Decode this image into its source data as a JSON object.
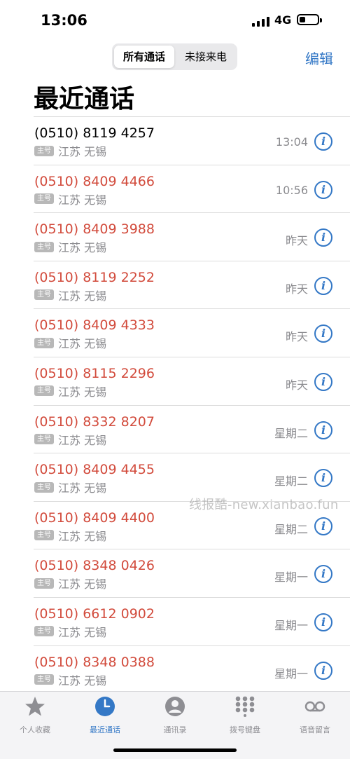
{
  "status": {
    "time": "13:06",
    "network": "4G"
  },
  "segmented": {
    "all_calls": "所有通话",
    "missed_calls": "未接来电"
  },
  "header": {
    "edit": "编辑",
    "title": "最近通话"
  },
  "calls": [
    {
      "number": "(0510) 8119 4257",
      "badge": "主号",
      "location": "江苏 无锡",
      "time": "13:04",
      "missed": false
    },
    {
      "number": "(0510) 8409 4466",
      "badge": "主号",
      "location": "江苏 无锡",
      "time": "10:56",
      "missed": true
    },
    {
      "number": "(0510) 8409 3988",
      "badge": "主号",
      "location": "江苏 无锡",
      "time": "昨天",
      "missed": true
    },
    {
      "number": "(0510) 8119 2252",
      "badge": "主号",
      "location": "江苏 无锡",
      "time": "昨天",
      "missed": true
    },
    {
      "number": "(0510) 8409 4333",
      "badge": "主号",
      "location": "江苏 无锡",
      "time": "昨天",
      "missed": true
    },
    {
      "number": "(0510) 8115 2296",
      "badge": "主号",
      "location": "江苏 无锡",
      "time": "昨天",
      "missed": true
    },
    {
      "number": "(0510) 8332 8207",
      "badge": "主号",
      "location": "江苏 无锡",
      "time": "星期二",
      "missed": true
    },
    {
      "number": "(0510) 8409 4455",
      "badge": "主号",
      "location": "江苏 无锡",
      "time": "星期二",
      "missed": true
    },
    {
      "number": "(0510) 8409 4400",
      "badge": "主号",
      "location": "江苏 无锡",
      "time": "星期二",
      "missed": true
    },
    {
      "number": "(0510) 8348 0426",
      "badge": "主号",
      "location": "江苏 无锡",
      "time": "星期一",
      "missed": true
    },
    {
      "number": "(0510) 6612 0902",
      "badge": "主号",
      "location": "江苏 无锡",
      "time": "星期一",
      "missed": true
    },
    {
      "number": "(0510) 8348 0388",
      "badge": "主号",
      "location": "江苏 无锡",
      "time": "星期一",
      "missed": true
    }
  ],
  "watermark": "线报酷-new.xianbao.fun",
  "tabs": [
    {
      "label": "个人收藏",
      "icon": "star-icon",
      "active": false
    },
    {
      "label": "最近通话",
      "icon": "clock-icon",
      "active": true
    },
    {
      "label": "通讯录",
      "icon": "person-icon",
      "active": false
    },
    {
      "label": "拨号键盘",
      "icon": "keypad-icon",
      "active": false
    },
    {
      "label": "语音留言",
      "icon": "voicemail-icon",
      "active": false
    }
  ],
  "colors": {
    "accent": "#3478c6",
    "missed": "#d24b3c",
    "secondary": "#8a8a8e"
  }
}
